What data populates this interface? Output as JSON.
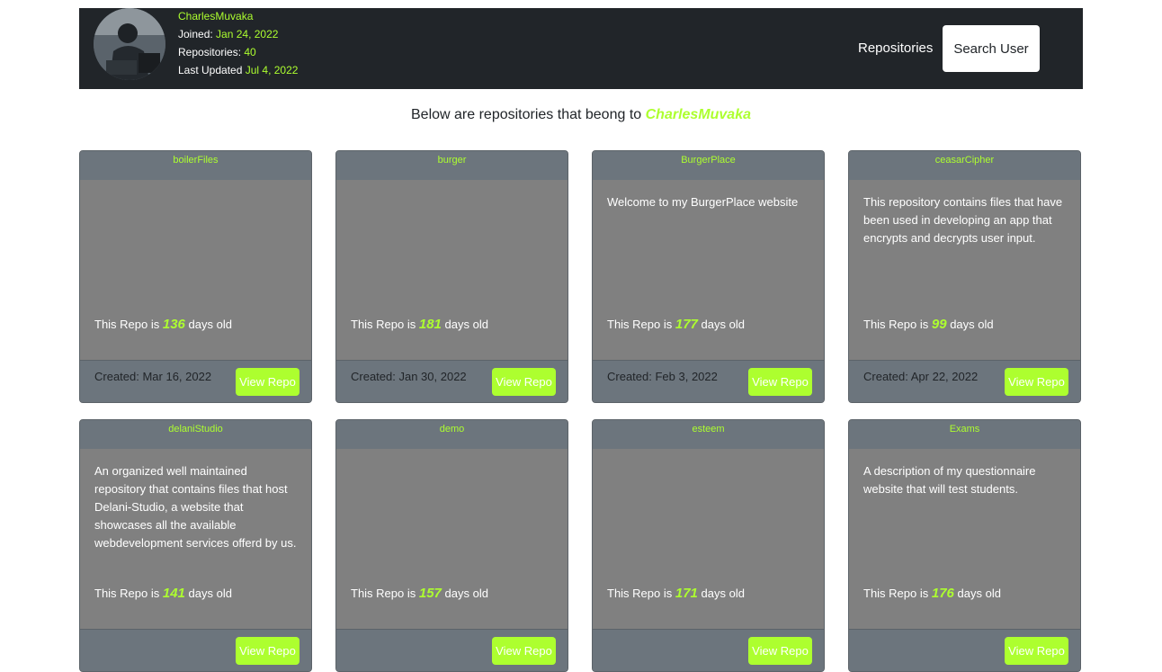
{
  "profile": {
    "username": "CharlesMuvaka",
    "joined_label": "Joined:",
    "joined_value": "Jan 24, 2022",
    "repos_label": "Repositories:",
    "repos_value": "40",
    "updated_label": "Last Updated",
    "updated_value": "Jul 4, 2022"
  },
  "nav": {
    "repositories_link": "Repositories",
    "search_button": "Search User"
  },
  "intro": {
    "text": "Below are repositories that beong to",
    "username": "CharlesMuvaka"
  },
  "card_labels": {
    "age_prefix": "This Repo is",
    "age_suffix": "days old",
    "view_button": "View Repo"
  },
  "repos": [
    {
      "name": "boilerFiles",
      "description": "",
      "days": "136",
      "created": "Created: Mar 16, 2022"
    },
    {
      "name": "burger",
      "description": "",
      "days": "181",
      "created": "Created: Jan 30, 2022"
    },
    {
      "name": "BurgerPlace",
      "description": "Welcome to my BurgerPlace website",
      "days": "177",
      "created": "Created: Feb 3, 2022"
    },
    {
      "name": "ceasarCipher",
      "description": "This repository contains files that have been used in developing an app that encrypts and decrypts user input.",
      "days": "99",
      "created": "Created: Apr 22, 2022"
    },
    {
      "name": "delaniStudio",
      "description": "An organized well maintained repository that contains files that host Delani-Studio, a website that showcases all the available webdevelopment services offerd by us.",
      "days": "141",
      "created": ""
    },
    {
      "name": "demo",
      "description": "",
      "days": "157",
      "created": ""
    },
    {
      "name": "esteem",
      "description": "",
      "days": "171",
      "created": ""
    },
    {
      "name": "Exams",
      "description": "A description of my questionnaire website that will test students.",
      "days": "176",
      "created": ""
    }
  ],
  "colors": {
    "accent": "#adff2f",
    "navbar": "#212529",
    "card_body": "#808080",
    "card_header": "#6c757d"
  }
}
